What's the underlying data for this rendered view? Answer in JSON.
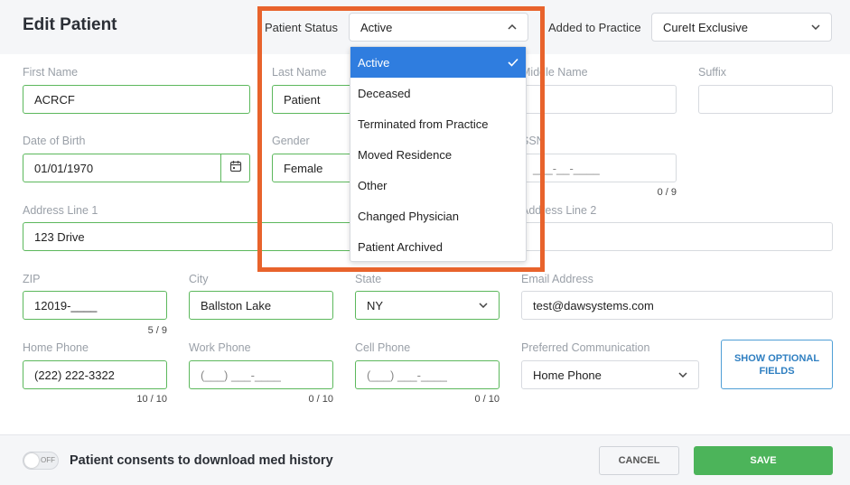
{
  "header": {
    "title": "Edit Patient",
    "patient_status_label": "Patient Status",
    "patient_status_value": "Active",
    "added_to_practice_label": "Added to Practice",
    "added_to_practice_value": "CureIt Exclusive"
  },
  "status_dropdown": {
    "options": [
      "Active",
      "Deceased",
      "Terminated from Practice",
      "Moved Residence",
      "Other",
      "Changed Physician",
      "Patient Archived"
    ],
    "selected": "Active"
  },
  "form": {
    "first_name": {
      "label": "First Name",
      "value": "ACRCF"
    },
    "last_name": {
      "label": "Last Name",
      "value": "Patient"
    },
    "middle_name": {
      "label": "Middle Name",
      "value": ""
    },
    "suffix": {
      "label": "Suffix",
      "value": ""
    },
    "dob": {
      "label": "Date of Birth",
      "value": "01/01/1970"
    },
    "gender": {
      "label": "Gender",
      "value": "Female"
    },
    "ssn": {
      "label": "SSN",
      "placeholder": "___-__-____",
      "counter": "0 / 9"
    },
    "address1": {
      "label": "Address Line 1",
      "value": "123 Drive"
    },
    "address2": {
      "label": "Address Line 2",
      "value": ""
    },
    "zip": {
      "label": "ZIP",
      "value": "12019-____",
      "counter": "5 / 9"
    },
    "city": {
      "label": "City",
      "value": "Ballston Lake"
    },
    "state": {
      "label": "State",
      "value": "NY"
    },
    "email": {
      "label": "Email Address",
      "value": "test@dawsystems.com"
    },
    "home_phone": {
      "label": "Home Phone",
      "value": "(222) 222-3322",
      "counter": "10 / 10"
    },
    "work_phone": {
      "label": "Work Phone",
      "placeholder": "(___) ___-____",
      "counter": "0 / 10"
    },
    "cell_phone": {
      "label": "Cell Phone",
      "placeholder": "(___) ___-____",
      "counter": "0 / 10"
    },
    "pref_comm": {
      "label": "Preferred Communication",
      "value": "Home Phone"
    },
    "show_optional_label": "SHOW OPTIONAL FIELDS"
  },
  "footer": {
    "toggle_label": "OFF",
    "consent_text": "Patient consents to download med history",
    "cancel_label": "CANCEL",
    "save_label": "SAVE"
  },
  "colors": {
    "highlight": "#e8632c",
    "valid_border": "#5cb85c",
    "save": "#4cb45a",
    "active_option": "#2f7ddf"
  }
}
